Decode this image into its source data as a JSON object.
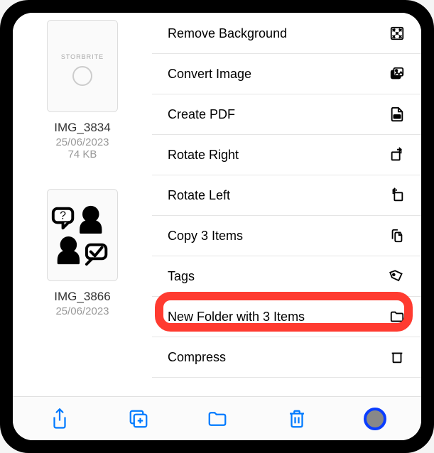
{
  "files": [
    {
      "name": "IMG_3834",
      "date": "25/06/2023",
      "size": "74 KB",
      "thumbLabel": "STORBRITE"
    },
    {
      "name": "IMG_3866",
      "date": "25/06/2023",
      "size": ""
    }
  ],
  "menu": {
    "removeBackground": "Remove Background",
    "convertImage": "Convert Image",
    "createPdf": "Create PDF",
    "rotateRight": "Rotate Right",
    "rotateLeft": "Rotate Left",
    "copyItems": "Copy 3 Items",
    "tags": "Tags",
    "newFolder": "New Folder with 3 Items",
    "compress": "Compress"
  },
  "colors": {
    "accent": "#007aff",
    "highlight": "#ff3b30"
  }
}
